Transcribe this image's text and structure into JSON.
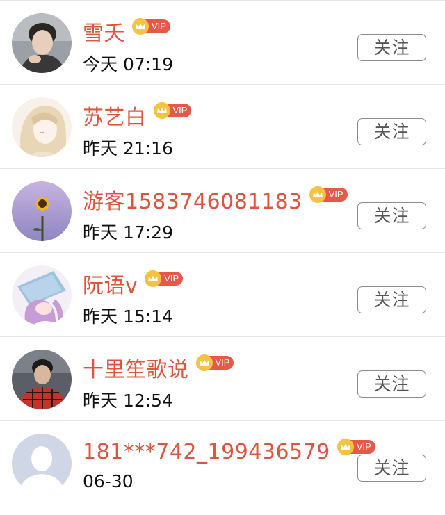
{
  "follow_label": "关注",
  "vip_label": "VIP",
  "users": [
    {
      "name": "雪夭",
      "time": "今天 07:19"
    },
    {
      "name": "苏艺白",
      "time": "昨天 21:16"
    },
    {
      "name": "游客1583746081183",
      "time": "昨天 17:29"
    },
    {
      "name": "阮语v",
      "time": "昨天 15:14"
    },
    {
      "name": "十里笙歌说",
      "time": "昨天 12:54"
    },
    {
      "name": "181***742_199436579",
      "time": "06-30"
    }
  ],
  "colors": {
    "name": "#e0543e",
    "vip_badge": "#e8584a",
    "crown": "#f5c342",
    "divider": "#e6e6e6"
  }
}
